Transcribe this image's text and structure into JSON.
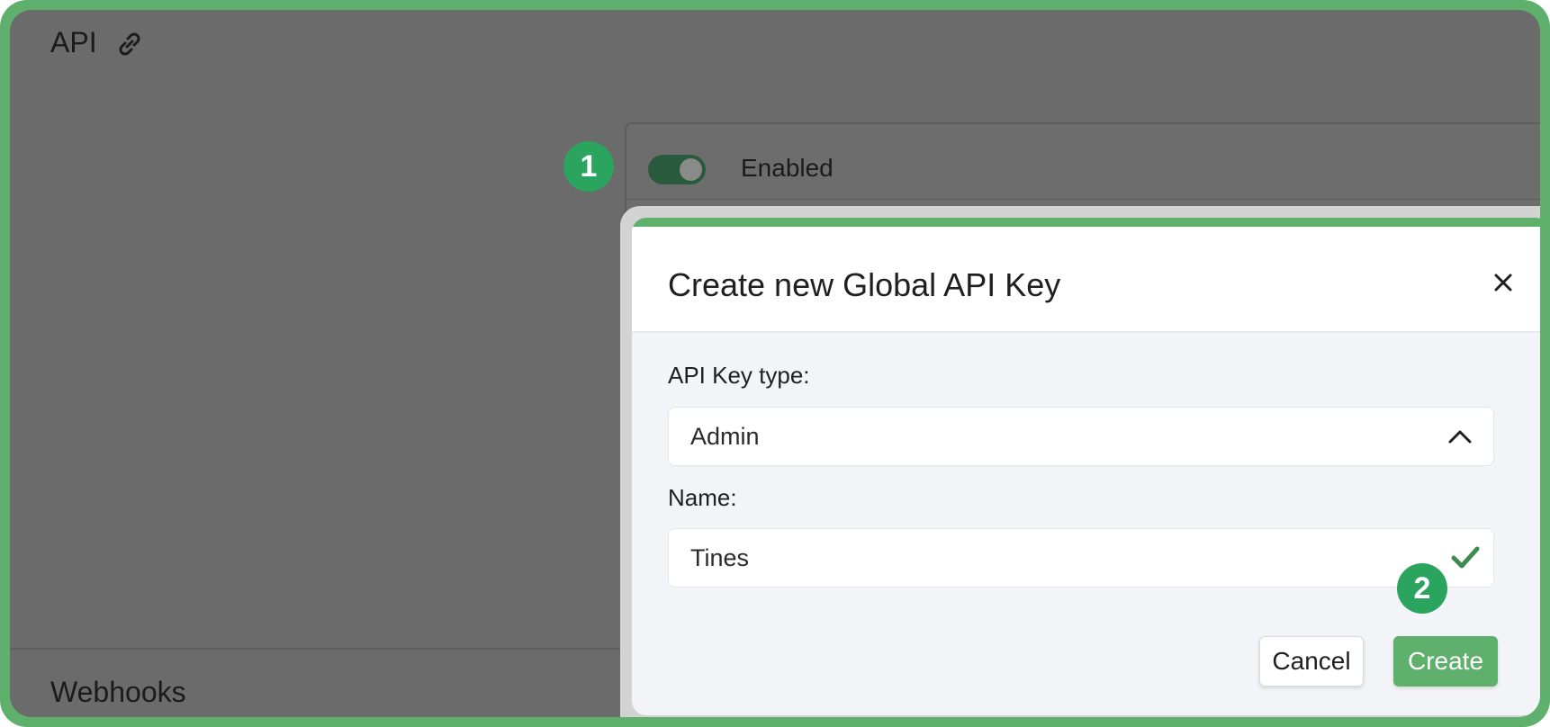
{
  "background_page": {
    "section_title": "API",
    "link_icon": "link-icon",
    "toggle_state": "on",
    "toggle_label": "Enabled",
    "next_section_title": "Webhooks"
  },
  "badges": {
    "step1": "1",
    "step2": "2"
  },
  "modal": {
    "title": "Create new Global API Key",
    "close_icon": "close-icon",
    "api_key_type_label": "API Key type:",
    "api_key_type_value": "Admin",
    "name_label": "Name:",
    "name_value": "Tines",
    "cancel_label": "Cancel",
    "create_label": "Create"
  },
  "colors": {
    "accent_green": "#5fb06c",
    "badge_green": "#2aa45e",
    "overlay_gray": "#6b6b6b",
    "modal_bg": "#f2f4f7"
  }
}
